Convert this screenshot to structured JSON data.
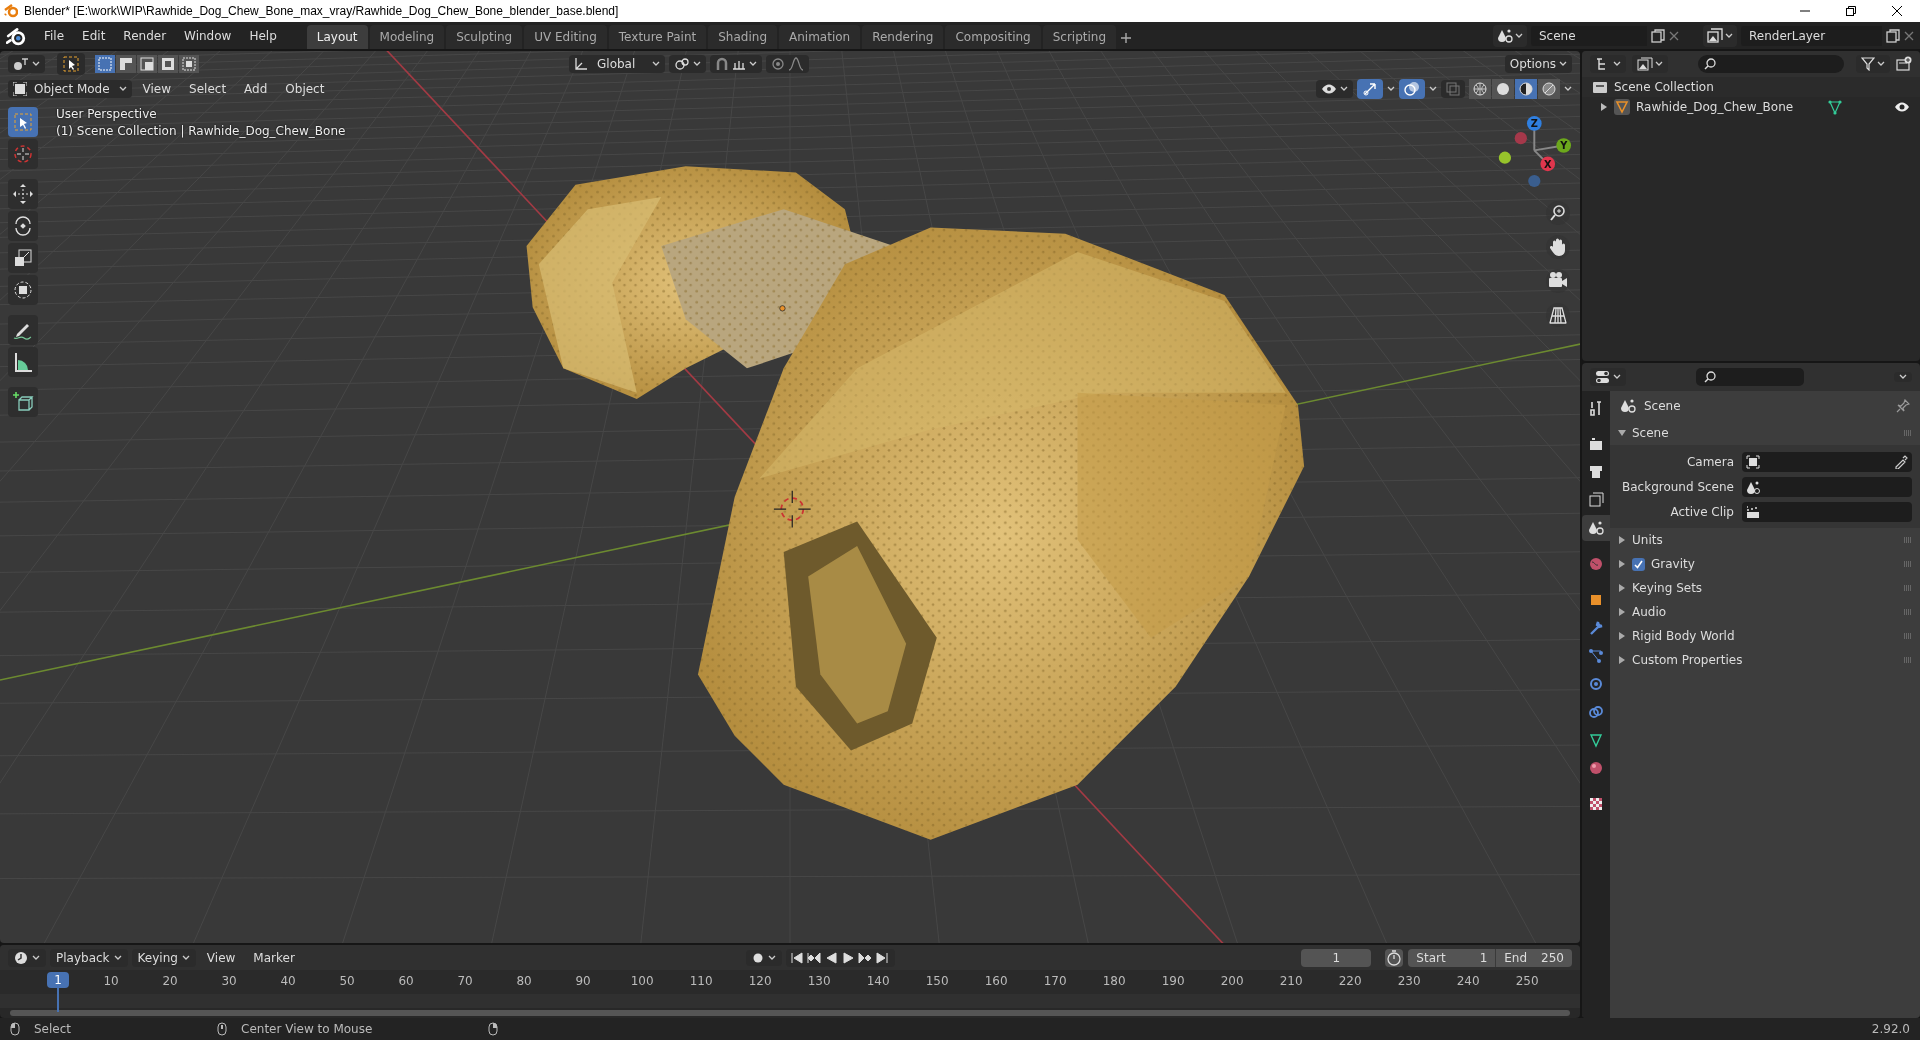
{
  "window": {
    "title": "Blender* [E:\\work\\WIP\\Rawhide_Dog_Chew_Bone_max_vray/Rawhide_Dog_Chew_Bone_blender_base.blend]"
  },
  "menu": [
    "File",
    "Edit",
    "Render",
    "Window",
    "Help"
  ],
  "workspaces": [
    {
      "label": "Layout",
      "selected": true
    },
    {
      "label": "Modeling",
      "selected": false
    },
    {
      "label": "Sculpting",
      "selected": false
    },
    {
      "label": "UV Editing",
      "selected": false
    },
    {
      "label": "Texture Paint",
      "selected": false
    },
    {
      "label": "Shading",
      "selected": false
    },
    {
      "label": "Animation",
      "selected": false
    },
    {
      "label": "Rendering",
      "selected": false
    },
    {
      "label": "Compositing",
      "selected": false
    },
    {
      "label": "Scripting",
      "selected": false
    }
  ],
  "scene_selector": {
    "value": "Scene"
  },
  "view_layer_selector": {
    "value": "RenderLayer"
  },
  "viewport": {
    "selection_modes": [
      {
        "selected": true
      },
      {
        "selected": false
      },
      {
        "selected": false
      },
      {
        "selected": false
      },
      {
        "selected": false
      }
    ],
    "transform_orientation": "Global",
    "proportional_editing": {
      "on": false
    },
    "options": "Options",
    "mode": "Object Mode",
    "menus": [
      "View",
      "Select",
      "Add",
      "Object"
    ],
    "shading": [
      {
        "kind": "wireframe",
        "selected": false
      },
      {
        "kind": "solid",
        "selected": false
      },
      {
        "kind": "material",
        "selected": true
      },
      {
        "kind": "rendered",
        "selected": false
      }
    ],
    "overlay_text": [
      "User Perspective",
      "(1) Scene Collection | Rawhide_Dog_Chew_Bone"
    ],
    "tools": [
      {
        "kind": "select",
        "selected": true
      },
      {
        "kind": "cursor",
        "selected": false
      },
      {
        "kind": "move",
        "selected": false
      },
      {
        "kind": "rotate",
        "selected": false
      },
      {
        "kind": "scale",
        "selected": false
      },
      {
        "kind": "transform",
        "selected": false
      },
      {
        "kind": "annotate",
        "selected": false
      },
      {
        "kind": "measure",
        "selected": false
      },
      {
        "kind": "add_cube",
        "selected": false
      }
    ],
    "gizmo_axes": [
      {
        "label": "Z",
        "color": "#2f7fe0"
      },
      {
        "label": "Y",
        "color": "#6ca81c"
      },
      {
        "label": "X",
        "color": "#e0364d"
      }
    ]
  },
  "outliner": {
    "items": [
      {
        "label": "Scene Collection",
        "children": [
          {
            "label": "Rawhide_Dog_Chew_Bone",
            "expanded": false
          }
        ]
      }
    ]
  },
  "properties": {
    "tabs": [
      {
        "kind": "tool",
        "selected": false
      },
      {
        "kind": "render",
        "selected": false
      },
      {
        "kind": "output",
        "selected": false
      },
      {
        "kind": "view_layer",
        "selected": false
      },
      {
        "kind": "scene",
        "selected": true
      },
      {
        "kind": "world",
        "selected": false
      },
      {
        "kind": "object",
        "selected": false
      },
      {
        "kind": "modifiers",
        "selected": false
      },
      {
        "kind": "particles",
        "selected": false
      },
      {
        "kind": "physics",
        "selected": false
      },
      {
        "kind": "constraints",
        "selected": false
      },
      {
        "kind": "data",
        "selected": false
      },
      {
        "kind": "material",
        "selected": false
      },
      {
        "kind": "texture",
        "selected": false
      }
    ],
    "context": "Scene",
    "panels": [
      {
        "kind": "panel",
        "label": "Scene",
        "expanded": true,
        "fields": [
          {
            "kind": "camera",
            "label": "Camera"
          },
          {
            "kind": "scene",
            "label": "Background Scene"
          },
          {
            "kind": "clip",
            "label": "Active Clip"
          }
        ]
      },
      {
        "kind": "panel",
        "label": "Units",
        "expanded": false
      },
      {
        "kind": "checkbox",
        "label": "Gravity",
        "expanded": false,
        "checked": true
      },
      {
        "kind": "panel",
        "label": "Keying Sets",
        "expanded": false
      },
      {
        "kind": "panel",
        "label": "Audio",
        "expanded": false
      },
      {
        "kind": "panel",
        "label": "Rigid Body World",
        "expanded": false
      },
      {
        "kind": "panel",
        "label": "Custom Properties",
        "expanded": false
      }
    ]
  },
  "timeline": {
    "menus": [
      "Playback",
      "Keying",
      "View",
      "Marker"
    ],
    "auto_keying": {
      "on": false
    },
    "current_frame": "1",
    "start_label": "Start",
    "start": "1",
    "end_label": "End",
    "end": "250",
    "playhead": "1",
    "ticks": [
      "10",
      "20",
      "30",
      "40",
      "50",
      "60",
      "70",
      "80",
      "90",
      "100",
      "110",
      "120",
      "130",
      "140",
      "150",
      "160",
      "170",
      "180",
      "190",
      "200",
      "210",
      "220",
      "230",
      "240",
      "250"
    ]
  },
  "status_bar": {
    "hints": [
      "Select",
      "Center View to Mouse"
    ],
    "version": "2.92.0"
  }
}
